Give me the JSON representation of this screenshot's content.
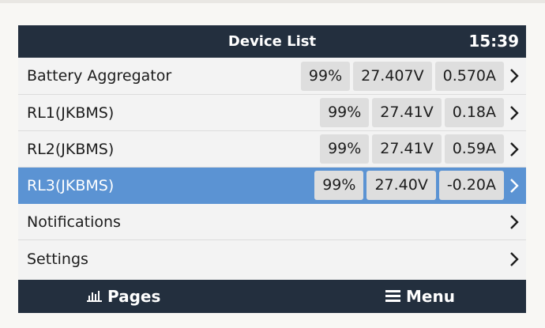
{
  "header": {
    "title": "Device List",
    "clock": "15:39"
  },
  "rows": [
    {
      "label": "Battery Aggregator",
      "soc": "99%",
      "voltage": "27.407V",
      "current": "0.570A",
      "selected": false
    },
    {
      "label": "RL1(JKBMS)",
      "soc": "99%",
      "voltage": "27.41V",
      "current": "0.18A",
      "selected": false
    },
    {
      "label": "RL2(JKBMS)",
      "soc": "99%",
      "voltage": "27.41V",
      "current": "0.59A",
      "selected": false
    },
    {
      "label": "RL3(JKBMS)",
      "soc": "99%",
      "voltage": "27.40V",
      "current": "-0.20A",
      "selected": true
    },
    {
      "label": "Notifications"
    },
    {
      "label": "Settings"
    }
  ],
  "footer": {
    "pages_label": "Pages",
    "pages_icon": "bar-chart-icon",
    "menu_label": "Menu",
    "menu_icon": "hamburger-menu-icon"
  },
  "colors": {
    "header_bg": "#232f3e",
    "selected_bg": "#5b93d3",
    "row_bg": "#f3f3f3",
    "value_box_bg": "#dedede"
  }
}
